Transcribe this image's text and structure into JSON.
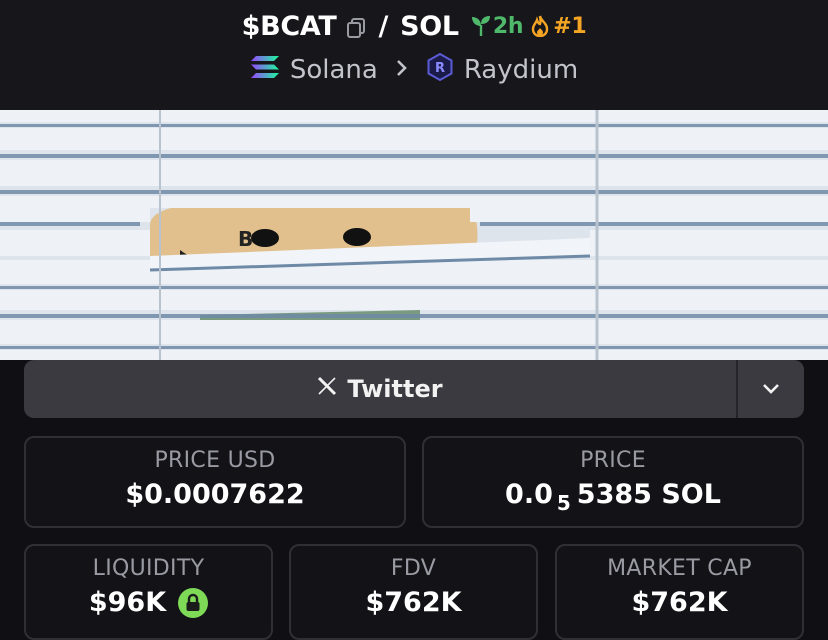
{
  "header": {
    "symbol": "$BCAT",
    "quote": "SOL",
    "age": "2h",
    "rank": "#1",
    "chain": "Solana",
    "dex": "Raydium"
  },
  "links": {
    "twitter_label": "Twitter"
  },
  "stats": {
    "price_usd_label": "PRICE USD",
    "price_usd_value": "$0.0007622",
    "price_label": "PRICE",
    "price_prefix": "0.0",
    "price_zeros": "5",
    "price_digits": "5385 SOL",
    "liquidity_label": "LIQUIDITY",
    "liquidity_value": "$96K",
    "fdv_label": "FDV",
    "fdv_value": "$762K",
    "mcap_label": "MARKET CAP",
    "mcap_value": "$762K"
  },
  "colors": {
    "background": "#16161b",
    "age_green": "#4fb86b",
    "rank_orange": "#f5a524",
    "lock_green": "#7ed957",
    "label_gray": "#9a9aa3"
  },
  "icons": [
    "copy-icon",
    "seedling-icon",
    "flame-icon",
    "solana-logo-icon",
    "chevron-right-icon",
    "raydium-logo-icon",
    "x-logo-icon",
    "chevron-down-icon",
    "lock-icon"
  ]
}
